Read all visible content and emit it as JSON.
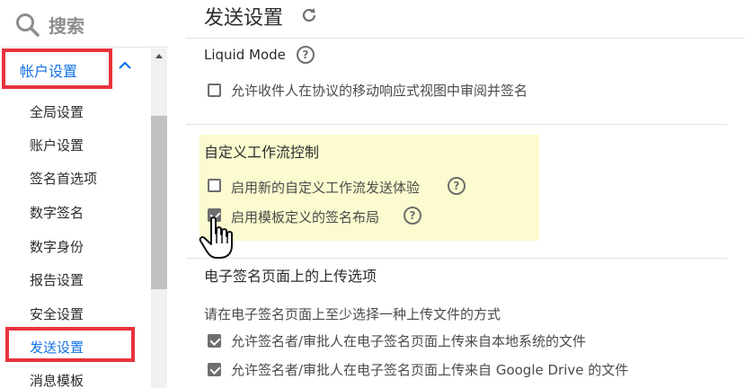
{
  "sidebar": {
    "search_placeholder": "搜索",
    "account_label": "帐户设置",
    "items": [
      {
        "label": "全局设置"
      },
      {
        "label": "账户设置"
      },
      {
        "label": "签名首选项"
      },
      {
        "label": "数字签名"
      },
      {
        "label": "数字身份"
      },
      {
        "label": "报告设置"
      },
      {
        "label": "安全设置"
      },
      {
        "label": "发送设置"
      },
      {
        "label": "消息模板"
      }
    ]
  },
  "main": {
    "title": "发送设置",
    "liquid_mode": {
      "title": "Liquid Mode",
      "options": [
        {
          "label": "允许收件人在协议的移动响应式视图中审阅并签名",
          "checked": false
        }
      ]
    },
    "custom_workflow": {
      "title": "自定义工作流控制",
      "options": [
        {
          "label": "启用新的自定义工作流发送体验",
          "checked": false
        },
        {
          "label": "启用模板定义的签名布局",
          "checked": true
        }
      ]
    },
    "upload": {
      "title": "电子签名页面上的上传选项",
      "hint": "请在电子签名页面上至少选择一种上传文件的方式",
      "options": [
        {
          "label": "允许签名者/审批人在电子签名页面上传来自本地系统的文件",
          "checked": true
        },
        {
          "label": "允许签名者/审批人在电子签名页面上传来自 Google Drive 的文件",
          "checked": true
        }
      ]
    }
  },
  "colors": {
    "accent": "#1473e6",
    "highlight_border": "#e8323c",
    "yellow_panel": "#fbfbcf"
  },
  "icons": [
    "search-icon",
    "chevron-up-icon",
    "refresh-icon",
    "help-icon",
    "hand-cursor-icon"
  ]
}
